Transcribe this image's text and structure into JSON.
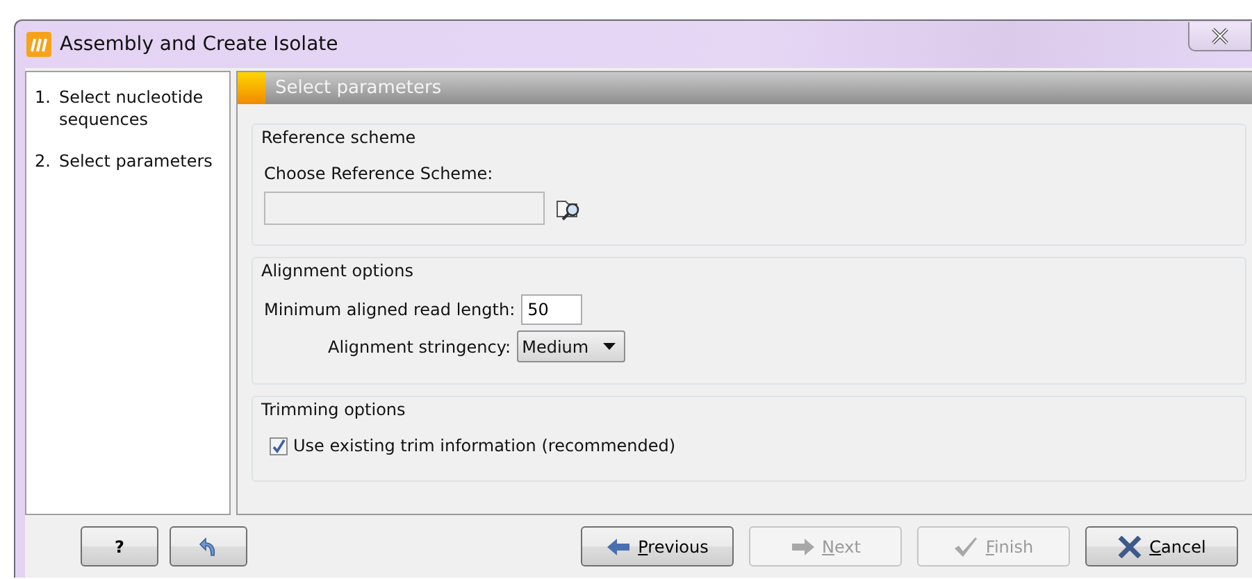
{
  "window": {
    "title": "Assembly and Create Isolate"
  },
  "steps": [
    {
      "number": "1.",
      "label": "Select nucleotide sequences"
    },
    {
      "number": "2.",
      "label": "Select parameters"
    }
  ],
  "panel_title": "Select parameters",
  "reference_scheme": {
    "title": "Reference scheme",
    "label": "Choose Reference Scheme:",
    "disabled": true
  },
  "alignment_options": {
    "title": "Alignment options",
    "min_length_label": "Minimum aligned read length:",
    "min_length_value": "50",
    "stringency_label": "Alignment stringency:",
    "stringency_value": "Medium"
  },
  "trimming_options": {
    "title": "Trimming options",
    "checkbox_label": "Use existing trim information (recommended)",
    "checked": true
  },
  "left_buttons": [
    {
      "kind": "help",
      "label": "?"
    },
    {
      "kind": "reset"
    }
  ],
  "buttons": [
    {
      "kind": "previous",
      "label": "Previous",
      "disabled": false
    },
    {
      "kind": "next",
      "label": "Next",
      "disabled": true
    },
    {
      "kind": "finish",
      "label": "Finish",
      "disabled": true
    },
    {
      "kind": "cancel",
      "label": "Cancel",
      "disabled": false
    }
  ]
}
